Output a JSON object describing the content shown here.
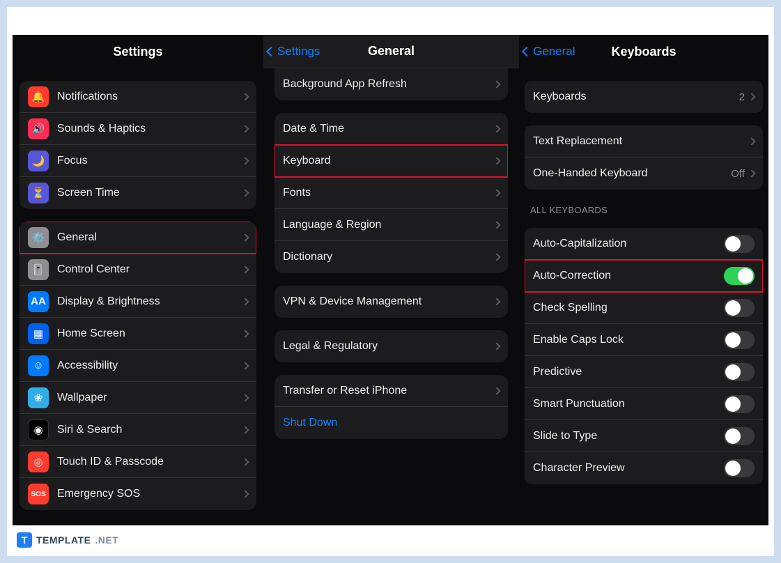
{
  "footer": {
    "brand_first": "TEMPLATE",
    "brand_second": ".NET",
    "logo_letter": "T"
  },
  "panel1": {
    "title": "Settings",
    "group1": [
      {
        "icon": "bell-icon",
        "icon_bg": "bg-red",
        "label": "Notifications"
      },
      {
        "icon": "speaker-icon",
        "icon_bg": "bg-pink",
        "label": "Sounds & Haptics"
      },
      {
        "icon": "moon-icon",
        "icon_bg": "bg-indigo",
        "label": "Focus"
      },
      {
        "icon": "hourglass-icon",
        "icon_bg": "bg-indigo",
        "label": "Screen Time"
      }
    ],
    "group2": [
      {
        "icon": "gear-icon",
        "icon_bg": "bg-gray",
        "label": "General",
        "highlight": true
      },
      {
        "icon": "switches-icon",
        "icon_bg": "bg-gray",
        "label": "Control Center"
      },
      {
        "icon": "text-aa-icon",
        "icon_bg": "bg-blue",
        "label": "Display & Brightness"
      },
      {
        "icon": "grid-icon",
        "icon_bg": "bg-bl2",
        "label": "Home Screen"
      },
      {
        "icon": "accessibility-icon",
        "icon_bg": "bg-blue",
        "label": "Accessibility"
      },
      {
        "icon": "flower-icon",
        "icon_bg": "bg-cyan",
        "label": "Wallpaper"
      },
      {
        "icon": "siri-icon",
        "icon_bg": "bg-black",
        "label": "Siri & Search"
      },
      {
        "icon": "fingerprint-icon",
        "icon_bg": "bg-red",
        "label": "Touch ID & Passcode"
      },
      {
        "icon": "sos-icon",
        "icon_bg": "bg-red",
        "label": "Emergency SOS"
      }
    ]
  },
  "panel2": {
    "back": "Settings",
    "title": "General",
    "tail": [
      {
        "label": "Background App Refresh"
      }
    ],
    "group1": [
      {
        "label": "Date & Time"
      },
      {
        "label": "Keyboard",
        "highlight": true
      },
      {
        "label": "Fonts"
      },
      {
        "label": "Language & Region"
      },
      {
        "label": "Dictionary"
      }
    ],
    "group2": [
      {
        "label": "VPN & Device Management"
      }
    ],
    "group3": [
      {
        "label": "Legal & Regulatory"
      }
    ],
    "group4": [
      {
        "label": "Transfer or Reset iPhone"
      },
      {
        "label": "Shut Down",
        "link": true
      }
    ]
  },
  "panel3": {
    "back": "General",
    "title": "Keyboards",
    "group1": [
      {
        "label": "Keyboards",
        "value": "2"
      }
    ],
    "group2": [
      {
        "label": "Text Replacement"
      },
      {
        "label": "One-Handed Keyboard",
        "value": "Off"
      }
    ],
    "section_label": "ALL KEYBOARDS",
    "toggles": [
      {
        "label": "Auto-Capitalization",
        "on": false
      },
      {
        "label": "Auto-Correction",
        "on": true,
        "highlight": true
      },
      {
        "label": "Check Spelling",
        "on": false
      },
      {
        "label": "Enable Caps Lock",
        "on": false
      },
      {
        "label": "Predictive",
        "on": false
      },
      {
        "label": "Smart Punctuation",
        "on": false
      },
      {
        "label": "Slide to Type",
        "on": false
      },
      {
        "label": "Character Preview",
        "on": false
      }
    ]
  }
}
